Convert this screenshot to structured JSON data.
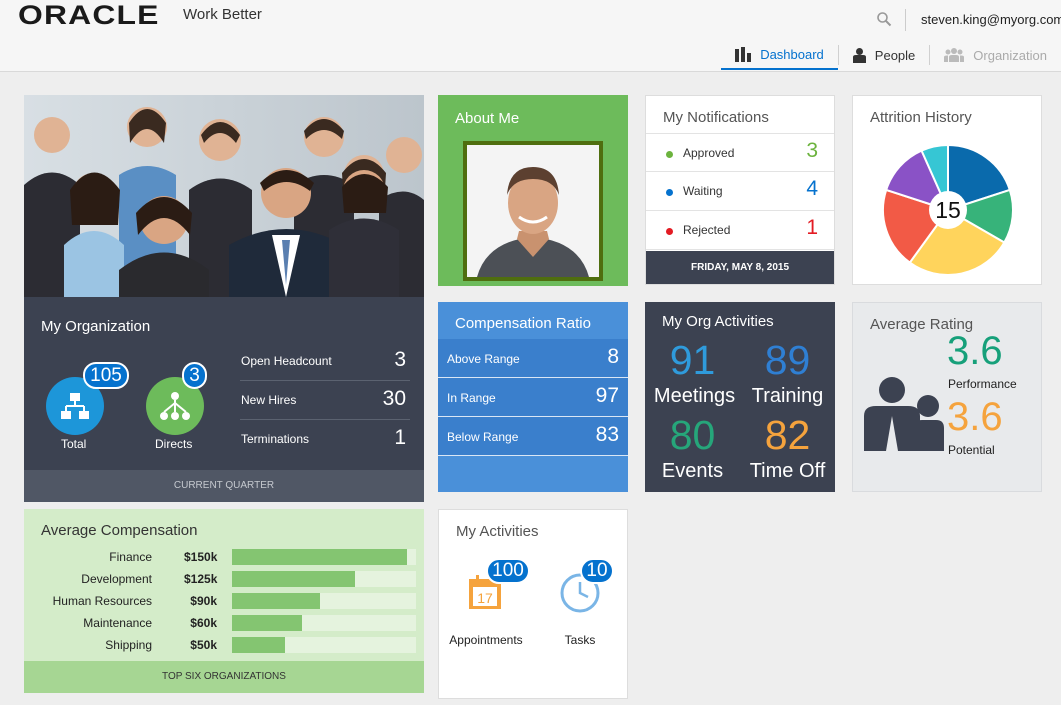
{
  "header": {
    "logo_text": "ORACLE",
    "tagline": "Work Better",
    "user_email": "steven.king@myorg.com",
    "icons": {
      "search": "search-icon"
    }
  },
  "nav": {
    "tabs": [
      {
        "label": "Dashboard",
        "icon": "bar-chart-icon",
        "active": true
      },
      {
        "label": "People",
        "icon": "person-icon"
      },
      {
        "label": "Organization",
        "icon": "group-icon",
        "disabled": true
      }
    ]
  },
  "my_organization": {
    "title": "My Organization",
    "total": {
      "label": "Total",
      "count": "105",
      "icon": "org-chart-icon"
    },
    "directs": {
      "label": "Directs",
      "count": "3",
      "icon": "hierarchy-icon"
    },
    "stats": [
      {
        "label": "Open Headcount",
        "value": "3"
      },
      {
        "label": "New Hires",
        "value": "30"
      },
      {
        "label": "Terminations",
        "value": "1"
      }
    ],
    "footer": "CURRENT QUARTER"
  },
  "about_me": {
    "title": "About Me"
  },
  "notifications": {
    "title": "My Notifications",
    "items": [
      {
        "label": "Approved",
        "value": "3",
        "color": "#6cb33e"
      },
      {
        "label": "Waiting",
        "value": "4",
        "color": "#0572ce"
      },
      {
        "label": "Rejected",
        "value": "1",
        "color": "#e31b23"
      }
    ],
    "date": "FRIDAY, MAY 8, 2015"
  },
  "attrition": {
    "title": "Attrition History",
    "center_value": "15",
    "slices": [
      {
        "value": 3,
        "color": "#0a6aac"
      },
      {
        "value": 2,
        "color": "#37b37a"
      },
      {
        "value": 4,
        "color": "#ffd45c"
      },
      {
        "value": 3,
        "color": "#f25a46"
      },
      {
        "value": 2,
        "color": "#8a52c6"
      },
      {
        "value": 1,
        "color": "#36c6d4"
      }
    ]
  },
  "compensation_ratio": {
    "title": "Compensation Ratio",
    "items": [
      {
        "label": "Above Range",
        "value": "8"
      },
      {
        "label": "In Range",
        "value": "97"
      },
      {
        "label": "Below Range",
        "value": "83"
      }
    ]
  },
  "org_activities": {
    "title": "My Org Activities",
    "items": [
      {
        "value": "91",
        "label": "Meetings",
        "color": "#2f9bdc"
      },
      {
        "value": "89",
        "label": "Training",
        "color": "#2f7fd3"
      },
      {
        "value": "80",
        "label": "Events",
        "color": "#26a67a"
      },
      {
        "value": "82",
        "label": "Time Off",
        "color": "#f5a33d"
      }
    ]
  },
  "average_rating": {
    "title": "Average Rating",
    "performance": {
      "value": "3.6",
      "label": "Performance",
      "color": "#16a07a"
    },
    "potential": {
      "value": "3.6",
      "label": "Potential",
      "color": "#f5a33d"
    }
  },
  "average_compensation": {
    "title": "Average Compensation",
    "rows": [
      {
        "label": "Finance",
        "value": "$150k",
        "fraction": 0.95
      },
      {
        "label": "Development",
        "value": "$125k",
        "fraction": 0.67
      },
      {
        "label": "Human Resources",
        "value": "$90k",
        "fraction": 0.48
      },
      {
        "label": "Maintenance",
        "value": "$60k",
        "fraction": 0.38
      },
      {
        "label": "Shipping",
        "value": "$50k",
        "fraction": 0.29
      }
    ],
    "footer": "TOP SIX ORGANIZATIONS"
  },
  "my_activities": {
    "title": "My Activities",
    "appointments": {
      "label": "Appointments",
      "count": "100",
      "calendar_day": "17"
    },
    "tasks": {
      "label": "Tasks",
      "count": "10"
    }
  }
}
